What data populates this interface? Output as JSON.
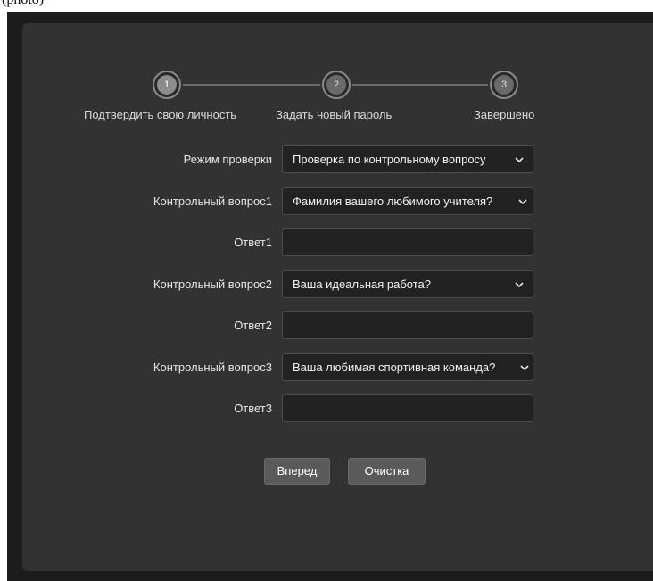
{
  "top_fragment": "(photo)",
  "stepper": {
    "steps": [
      {
        "number": "1",
        "label": "Подтвердить свою личность",
        "active": true
      },
      {
        "number": "2",
        "label": "Задать новый пароль",
        "active": false
      },
      {
        "number": "3",
        "label": "Завершено",
        "active": false
      }
    ]
  },
  "form": {
    "mode": {
      "label": "Режим проверки",
      "value": "Проверка по контрольному вопросу"
    },
    "question1": {
      "label": "Контрольный вопрос1",
      "value": "Фамилия вашего любимого учителя?"
    },
    "answer1": {
      "label": "Ответ1",
      "value": ""
    },
    "question2": {
      "label": "Контрольный вопрос2",
      "value": "Ваша идеальная работа?"
    },
    "answer2": {
      "label": "Ответ2",
      "value": ""
    },
    "question3": {
      "label": "Контрольный вопрос3",
      "value": "Ваша любимая спортивная команда?"
    },
    "answer3": {
      "label": "Ответ3",
      "value": ""
    }
  },
  "buttons": {
    "next_label": "Вперед",
    "clear_label": "Очистка"
  },
  "icons": {
    "dropdown": "chevron-down-icon"
  },
  "colors": {
    "background": "#1c1c1c",
    "panel": "#323232",
    "button": "#5a5a5a",
    "step_active": "#8c8c8c"
  }
}
